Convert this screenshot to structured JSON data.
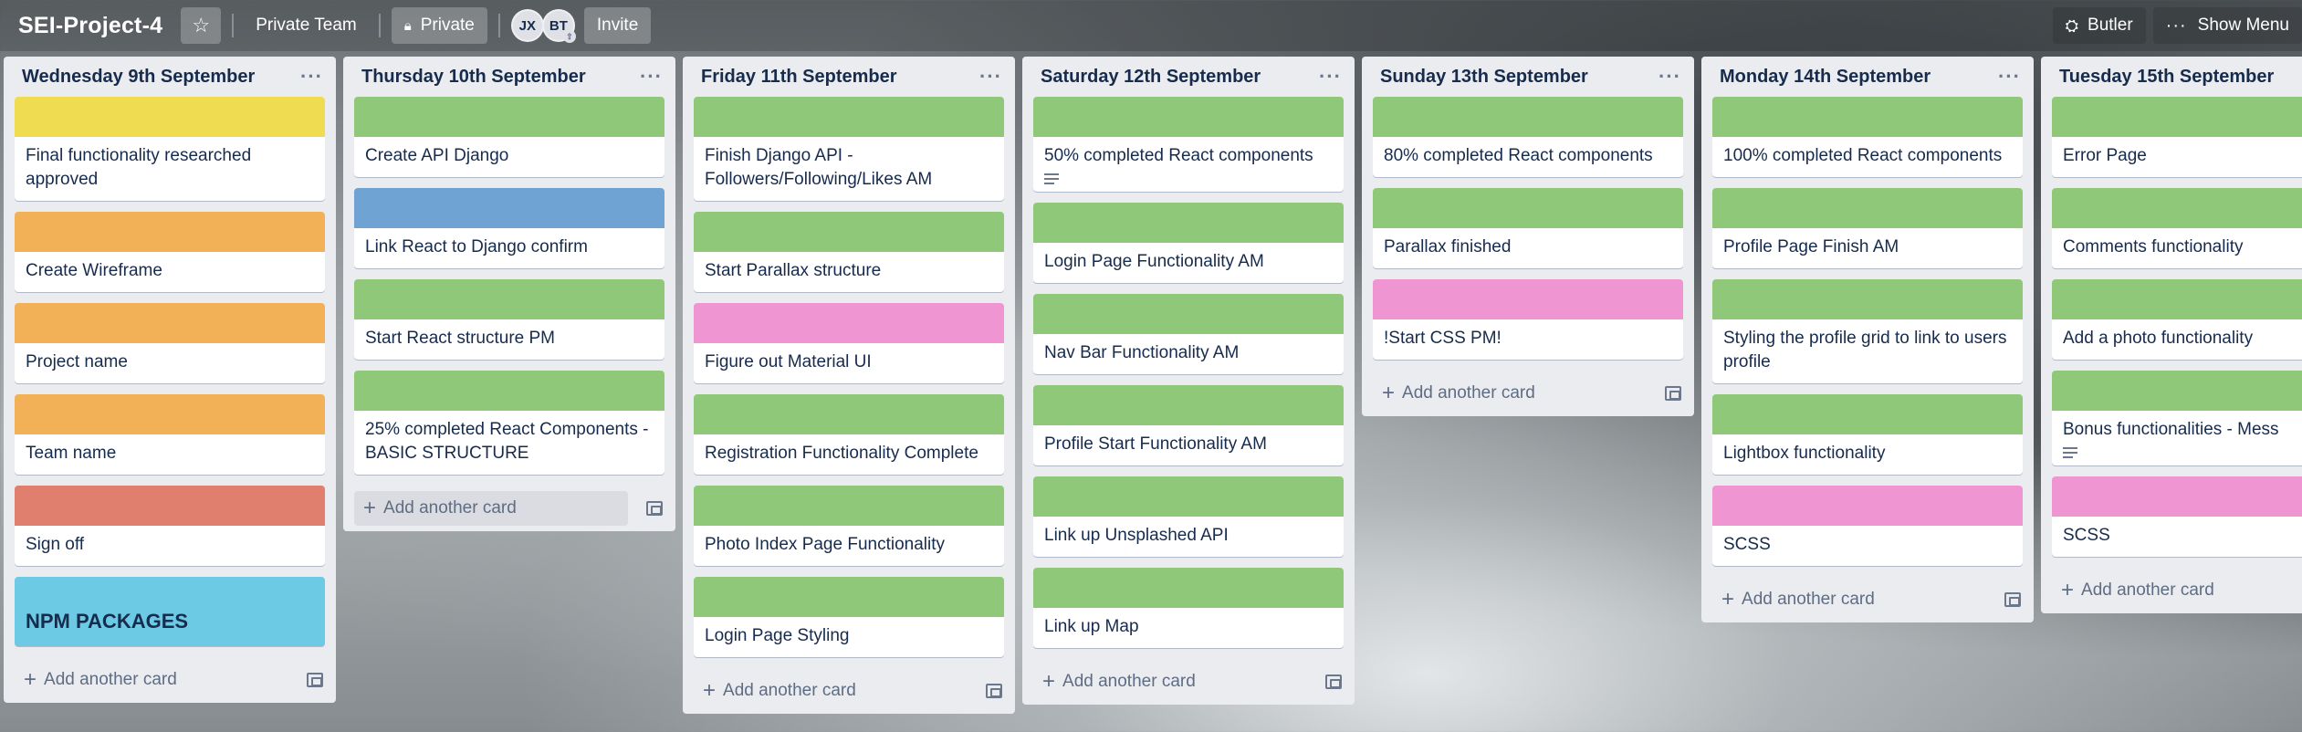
{
  "header": {
    "board_title": "SEI-Project-4",
    "team_label": "Private Team",
    "visibility_label": "Private",
    "invite_label": "Invite",
    "members": [
      "JX",
      "BT"
    ],
    "butler_label": "Butler",
    "show_menu_label": "Show Menu"
  },
  "colors": {
    "green": "#8fc878",
    "yellow": "#f0dc50",
    "orange": "#f2b157",
    "red": "#e17f6f",
    "blue": "#6fa3d4",
    "pink": "#ef95d2",
    "sky": "#6ccae4"
  },
  "add_card_label": "Add another card",
  "lists": [
    {
      "title": "Wednesday 9th September",
      "cards": [
        {
          "label": "yellow",
          "text": "Final functionality researched approved"
        },
        {
          "label": "orange",
          "text": "Create Wireframe"
        },
        {
          "label": "orange",
          "text": "Project name"
        },
        {
          "label": "orange",
          "text": "Team name"
        },
        {
          "label": "red",
          "text": "Sign off"
        },
        {
          "label": "sky",
          "text": "NPM PACKAGES",
          "big": true
        }
      ]
    },
    {
      "title": "Thursday 10th September",
      "cards": [
        {
          "label": "green",
          "text": "Create API Django"
        },
        {
          "label": "blue",
          "text": "Link React to Django confirm"
        },
        {
          "label": "green",
          "text": "Start React structure PM"
        },
        {
          "label": "green",
          "text": "25% completed React Components - BASIC STRUCTURE"
        }
      ]
    },
    {
      "title": "Friday 11th September",
      "cards": [
        {
          "label": "green",
          "text": "Finish Django API - Followers/Following/Likes AM"
        },
        {
          "label": "green",
          "text": "Start Parallax structure"
        },
        {
          "label": "pink",
          "text": "Figure out Material UI"
        },
        {
          "label": "green",
          "text": "Registration Functionality Complete"
        },
        {
          "label": "green",
          "text": "Photo Index Page Functionality"
        },
        {
          "label": "green",
          "text": "Login Page Styling"
        }
      ]
    },
    {
      "title": "Saturday 12th September",
      "cards": [
        {
          "label": "green",
          "text": "50% completed React components",
          "desc": true
        },
        {
          "label": "green",
          "text": "Login Page Functionality AM"
        },
        {
          "label": "green",
          "text": "Nav Bar Functionality AM"
        },
        {
          "label": "green",
          "text": "Profile Start Functionality AM"
        },
        {
          "label": "green",
          "text": "Link up Unsplashed API"
        },
        {
          "label": "green",
          "text": "Link up Map"
        }
      ]
    },
    {
      "title": "Sunday 13th September",
      "cards": [
        {
          "label": "green",
          "text": "80% completed React components"
        },
        {
          "label": "green",
          "text": "Parallax finished"
        },
        {
          "label": "pink",
          "text": "!Start CSS PM!"
        }
      ]
    },
    {
      "title": "Monday 14th September",
      "cards": [
        {
          "label": "green",
          "text": "100% completed React components"
        },
        {
          "label": "green",
          "text": "Profile Page Finish AM"
        },
        {
          "label": "green",
          "text": "Styling the profile grid to link to users profile"
        },
        {
          "label": "green",
          "text": "Lightbox functionality"
        },
        {
          "label": "pink",
          "text": "SCSS"
        }
      ]
    },
    {
      "title": "Tuesday 15th September",
      "cards": [
        {
          "label": "green",
          "text": "Error Page"
        },
        {
          "label": "green",
          "text": "Comments functionality"
        },
        {
          "label": "green",
          "text": "Add a photo functionality"
        },
        {
          "label": "green",
          "text": "Bonus functionalities - Mess",
          "desc": true
        },
        {
          "label": "pink",
          "text": "SCSS"
        }
      ]
    }
  ]
}
